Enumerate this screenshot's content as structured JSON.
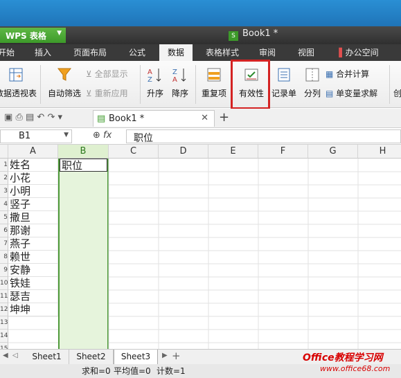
{
  "app": {
    "menu_label": "WPS 表格",
    "doc_title": "Book1 *"
  },
  "menu_tabs": [
    "开始",
    "插入",
    "页面布局",
    "公式",
    "数据",
    "表格样式",
    "审阅",
    "视图",
    "办公空间"
  ],
  "ribbon": {
    "pivot": "数据透视表",
    "autofilter": "自动筛选",
    "show_all": "全部显示",
    "reapply": "重新应用",
    "sort_asc": "升序",
    "sort_desc": "降序",
    "duplicates": "重复项",
    "validation": "有效性",
    "record": "记录单",
    "split": "分列",
    "consolidate": "合并计算",
    "solver": "单变量求解",
    "create": "创"
  },
  "doc_tab": "Book1 *",
  "formula": {
    "name_box": "B1",
    "fx": "fx",
    "value": "职位"
  },
  "columns": [
    "A",
    "B",
    "C",
    "D",
    "E",
    "F",
    "G",
    "H"
  ],
  "rows": [
    "1",
    "2",
    "3",
    "4",
    "5",
    "6",
    "7",
    "8",
    "9",
    "10",
    "11",
    "12",
    "13",
    "14",
    "15"
  ],
  "cells_a": [
    "姓名",
    "小花",
    "小明",
    "竖子",
    "撒旦",
    "那谢",
    "燕子",
    "赖世",
    "安静",
    "铁娃",
    "瑟吉",
    "坤坤"
  ],
  "cell_b1": "职位",
  "sheets": [
    "Sheet1",
    "Sheet2",
    "Sheet3"
  ],
  "status": {
    "sum": "求和=0",
    "avg": "平均值=0",
    "count": "计数=1"
  },
  "watermark": {
    "line1": "Office教程学习网",
    "line2": "www.office68.com"
  },
  "colors": {
    "accent_green": "#3d9a2a",
    "highlight_red": "#d42323"
  }
}
